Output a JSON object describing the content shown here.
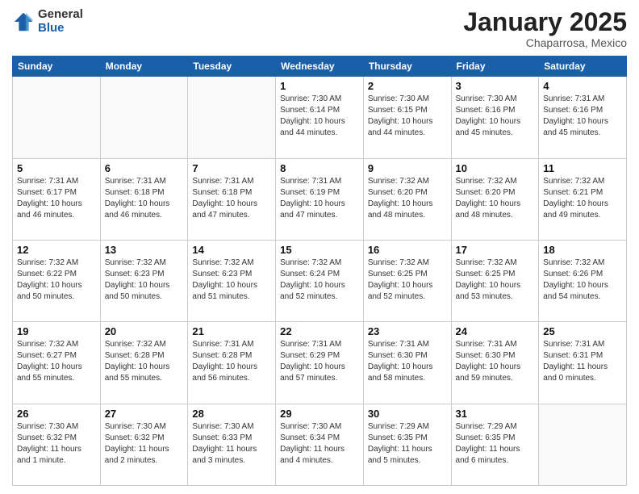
{
  "logo": {
    "general": "General",
    "blue": "Blue"
  },
  "header": {
    "month": "January 2025",
    "location": "Chaparrosa, Mexico"
  },
  "weekdays": [
    "Sunday",
    "Monday",
    "Tuesday",
    "Wednesday",
    "Thursday",
    "Friday",
    "Saturday"
  ],
  "weeks": [
    [
      {
        "day": "",
        "info": ""
      },
      {
        "day": "",
        "info": ""
      },
      {
        "day": "",
        "info": ""
      },
      {
        "day": "1",
        "info": "Sunrise: 7:30 AM\nSunset: 6:14 PM\nDaylight: 10 hours\nand 44 minutes."
      },
      {
        "day": "2",
        "info": "Sunrise: 7:30 AM\nSunset: 6:15 PM\nDaylight: 10 hours\nand 44 minutes."
      },
      {
        "day": "3",
        "info": "Sunrise: 7:30 AM\nSunset: 6:16 PM\nDaylight: 10 hours\nand 45 minutes."
      },
      {
        "day": "4",
        "info": "Sunrise: 7:31 AM\nSunset: 6:16 PM\nDaylight: 10 hours\nand 45 minutes."
      }
    ],
    [
      {
        "day": "5",
        "info": "Sunrise: 7:31 AM\nSunset: 6:17 PM\nDaylight: 10 hours\nand 46 minutes."
      },
      {
        "day": "6",
        "info": "Sunrise: 7:31 AM\nSunset: 6:18 PM\nDaylight: 10 hours\nand 46 minutes."
      },
      {
        "day": "7",
        "info": "Sunrise: 7:31 AM\nSunset: 6:18 PM\nDaylight: 10 hours\nand 47 minutes."
      },
      {
        "day": "8",
        "info": "Sunrise: 7:31 AM\nSunset: 6:19 PM\nDaylight: 10 hours\nand 47 minutes."
      },
      {
        "day": "9",
        "info": "Sunrise: 7:32 AM\nSunset: 6:20 PM\nDaylight: 10 hours\nand 48 minutes."
      },
      {
        "day": "10",
        "info": "Sunrise: 7:32 AM\nSunset: 6:20 PM\nDaylight: 10 hours\nand 48 minutes."
      },
      {
        "day": "11",
        "info": "Sunrise: 7:32 AM\nSunset: 6:21 PM\nDaylight: 10 hours\nand 49 minutes."
      }
    ],
    [
      {
        "day": "12",
        "info": "Sunrise: 7:32 AM\nSunset: 6:22 PM\nDaylight: 10 hours\nand 50 minutes."
      },
      {
        "day": "13",
        "info": "Sunrise: 7:32 AM\nSunset: 6:23 PM\nDaylight: 10 hours\nand 50 minutes."
      },
      {
        "day": "14",
        "info": "Sunrise: 7:32 AM\nSunset: 6:23 PM\nDaylight: 10 hours\nand 51 minutes."
      },
      {
        "day": "15",
        "info": "Sunrise: 7:32 AM\nSunset: 6:24 PM\nDaylight: 10 hours\nand 52 minutes."
      },
      {
        "day": "16",
        "info": "Sunrise: 7:32 AM\nSunset: 6:25 PM\nDaylight: 10 hours\nand 52 minutes."
      },
      {
        "day": "17",
        "info": "Sunrise: 7:32 AM\nSunset: 6:25 PM\nDaylight: 10 hours\nand 53 minutes."
      },
      {
        "day": "18",
        "info": "Sunrise: 7:32 AM\nSunset: 6:26 PM\nDaylight: 10 hours\nand 54 minutes."
      }
    ],
    [
      {
        "day": "19",
        "info": "Sunrise: 7:32 AM\nSunset: 6:27 PM\nDaylight: 10 hours\nand 55 minutes."
      },
      {
        "day": "20",
        "info": "Sunrise: 7:32 AM\nSunset: 6:28 PM\nDaylight: 10 hours\nand 55 minutes."
      },
      {
        "day": "21",
        "info": "Sunrise: 7:31 AM\nSunset: 6:28 PM\nDaylight: 10 hours\nand 56 minutes."
      },
      {
        "day": "22",
        "info": "Sunrise: 7:31 AM\nSunset: 6:29 PM\nDaylight: 10 hours\nand 57 minutes."
      },
      {
        "day": "23",
        "info": "Sunrise: 7:31 AM\nSunset: 6:30 PM\nDaylight: 10 hours\nand 58 minutes."
      },
      {
        "day": "24",
        "info": "Sunrise: 7:31 AM\nSunset: 6:30 PM\nDaylight: 10 hours\nand 59 minutes."
      },
      {
        "day": "25",
        "info": "Sunrise: 7:31 AM\nSunset: 6:31 PM\nDaylight: 11 hours\nand 0 minutes."
      }
    ],
    [
      {
        "day": "26",
        "info": "Sunrise: 7:30 AM\nSunset: 6:32 PM\nDaylight: 11 hours\nand 1 minute."
      },
      {
        "day": "27",
        "info": "Sunrise: 7:30 AM\nSunset: 6:32 PM\nDaylight: 11 hours\nand 2 minutes."
      },
      {
        "day": "28",
        "info": "Sunrise: 7:30 AM\nSunset: 6:33 PM\nDaylight: 11 hours\nand 3 minutes."
      },
      {
        "day": "29",
        "info": "Sunrise: 7:30 AM\nSunset: 6:34 PM\nDaylight: 11 hours\nand 4 minutes."
      },
      {
        "day": "30",
        "info": "Sunrise: 7:29 AM\nSunset: 6:35 PM\nDaylight: 11 hours\nand 5 minutes."
      },
      {
        "day": "31",
        "info": "Sunrise: 7:29 AM\nSunset: 6:35 PM\nDaylight: 11 hours\nand 6 minutes."
      },
      {
        "day": "",
        "info": ""
      }
    ]
  ]
}
